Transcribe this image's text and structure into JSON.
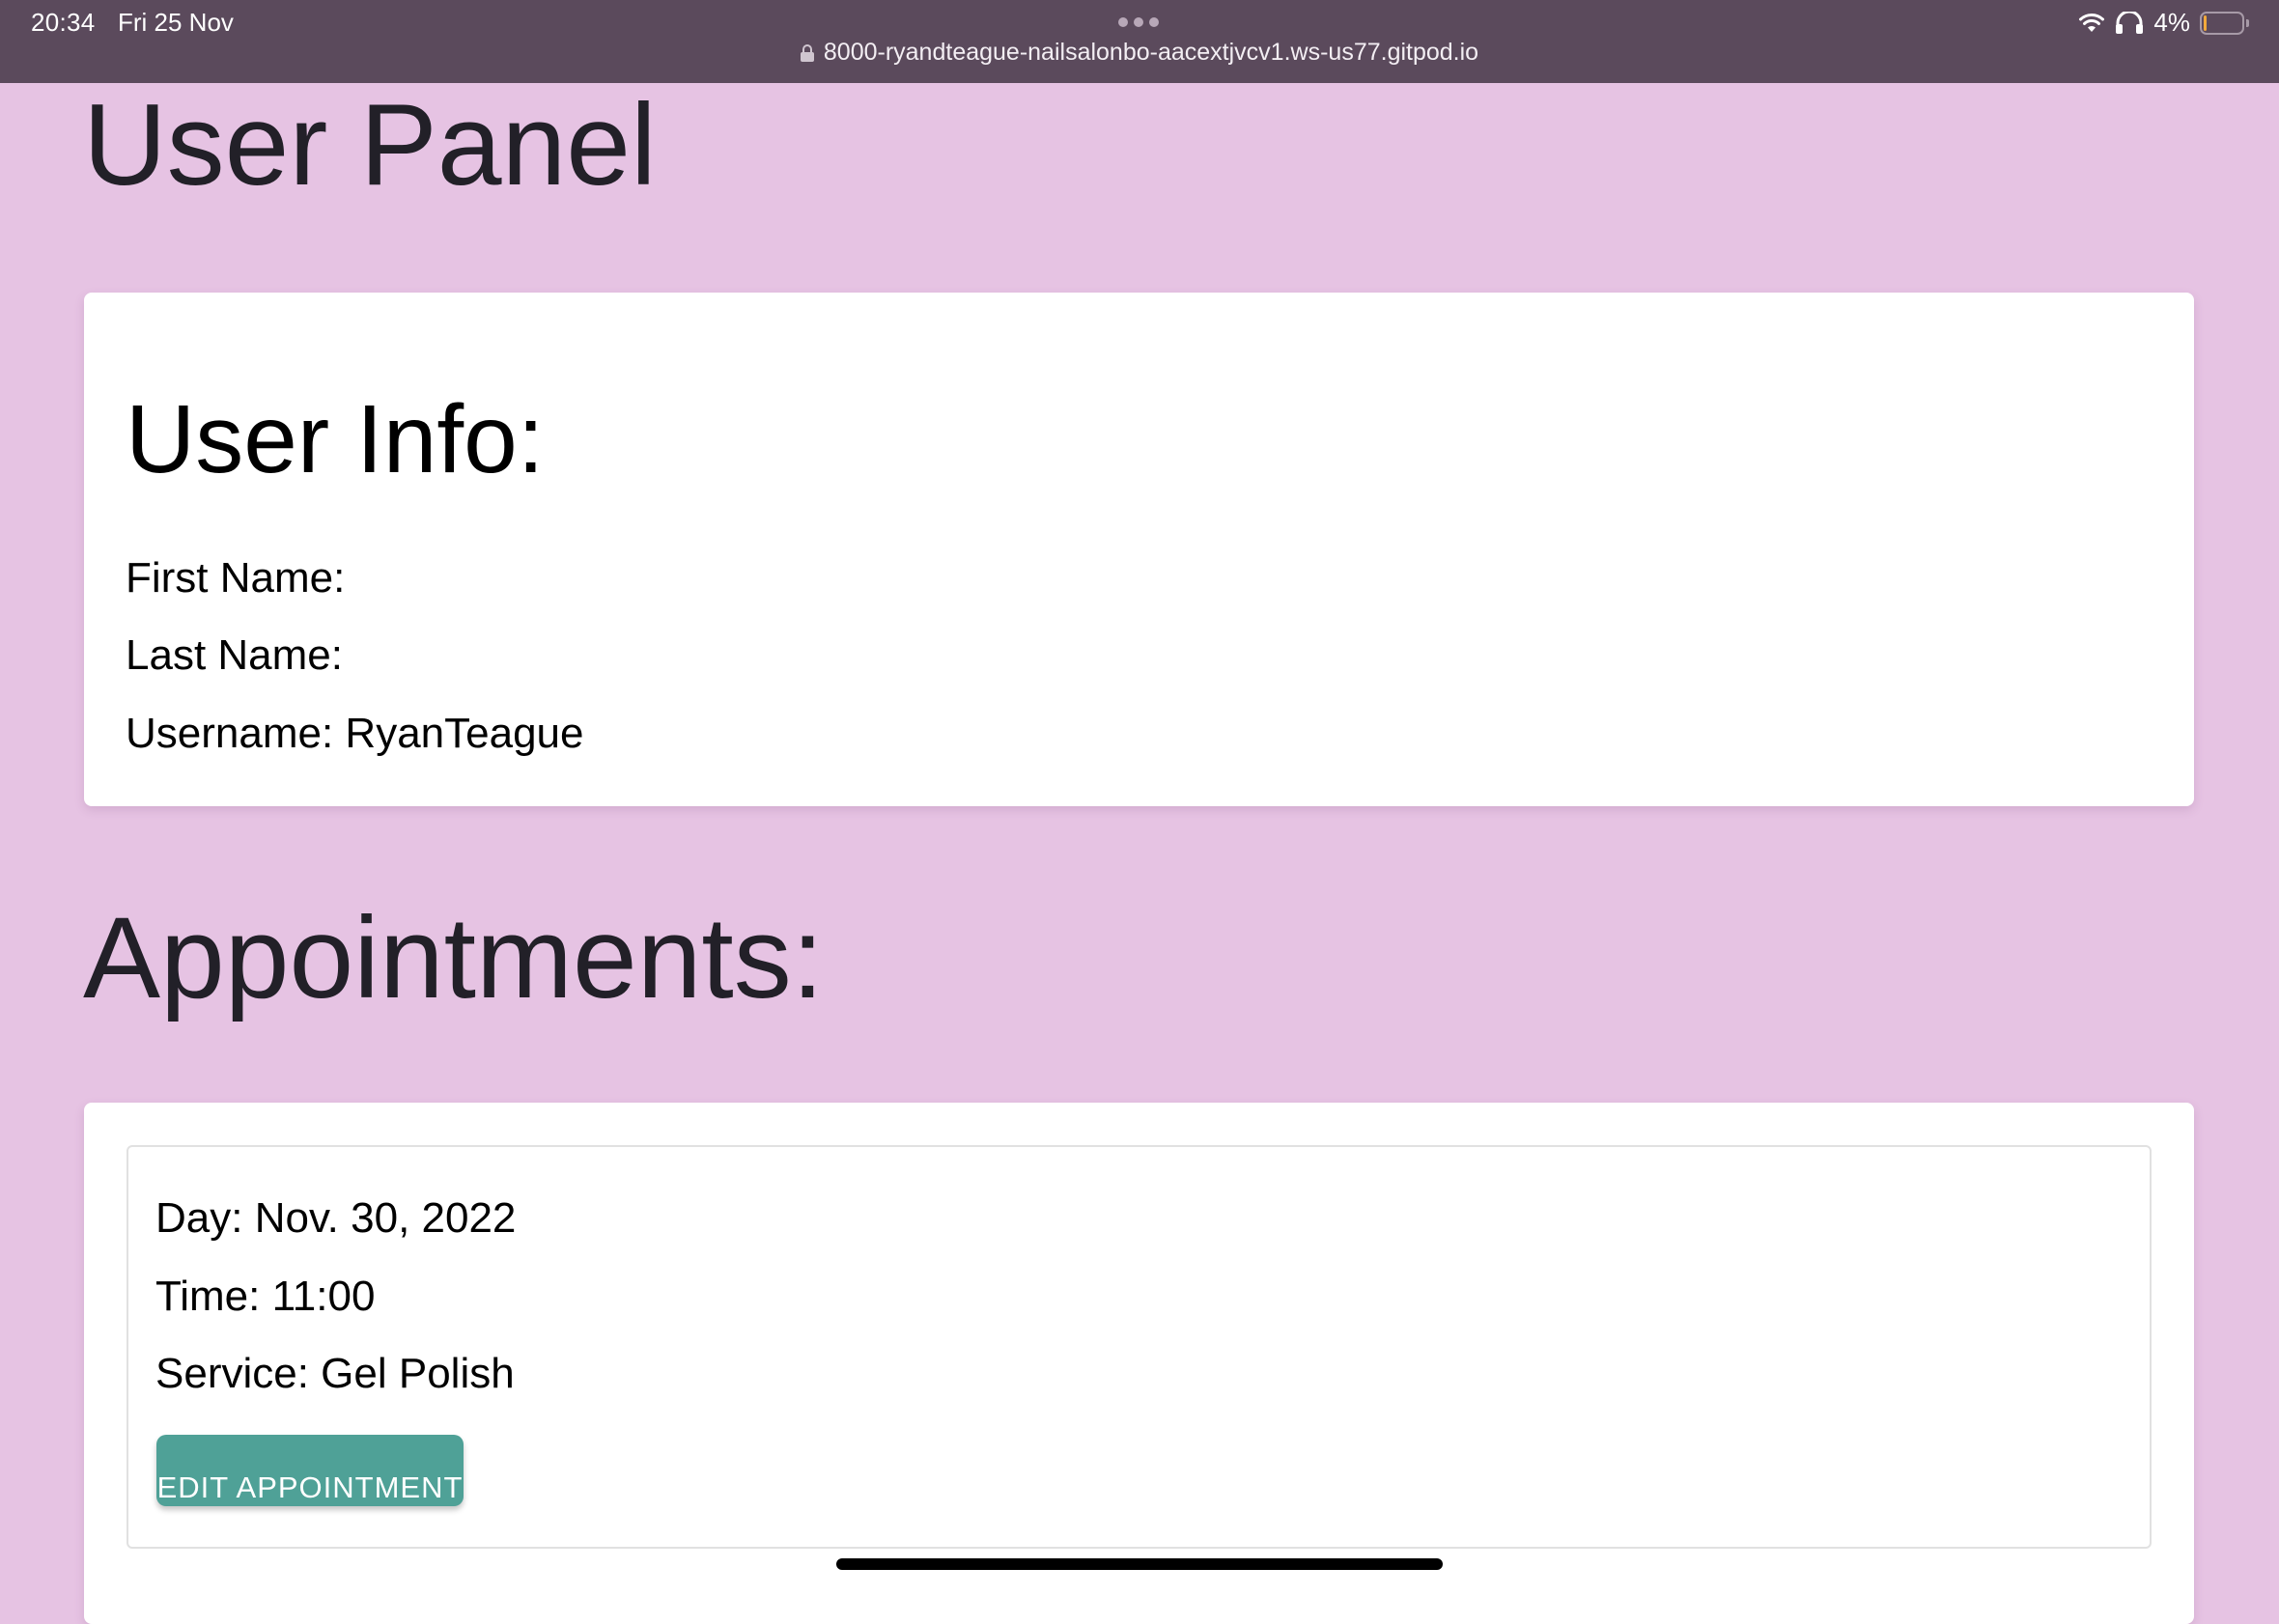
{
  "status_bar": {
    "time": "20:34",
    "date": "Fri 25 Nov",
    "url": "8000-ryandteague-nailsalonbo-aacextjvcv1.ws-us77.gitpod.io",
    "battery_percent": "4%",
    "battery_level": 0.04,
    "icons": [
      "lock-icon",
      "more-dots-icon",
      "wifi-icon",
      "headphones-icon",
      "battery-icon"
    ]
  },
  "page": {
    "title": "User Panel"
  },
  "user_info": {
    "heading": "User Info:",
    "first_name": "First Name:",
    "last_name": "Last Name:",
    "username": "Username: RyanTeague"
  },
  "appointments": {
    "heading": "Appointments:",
    "items": [
      {
        "day": "Day: Nov. 30, 2022",
        "time": "Time: 11:00",
        "service": "Service: Gel Polish",
        "edit_label": "EDIT APPOINTMENT"
      }
    ]
  },
  "colors": {
    "background": "#e6c3e3",
    "status_bar": "#5b4a5c",
    "button": "#4fa197",
    "card": "#ffffff"
  }
}
